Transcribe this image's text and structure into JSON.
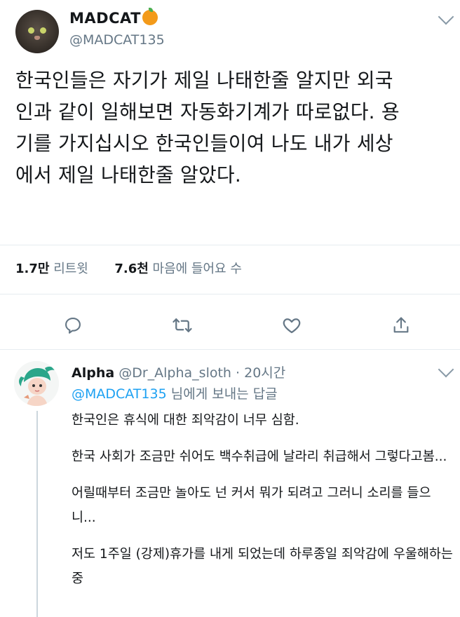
{
  "tweet": {
    "display_name": "MADCAT",
    "handle": "@MADCAT135",
    "text": "한국인들은 자기가 제일 나태한줄 알지만 외국\n인과 같이 일해보면 자동화기계가 따로없다. 용\n기를 가지십시오 한국인들이여 나도 내가 세상\n에서 제일 나태한줄 알았다.",
    "retweet_count": "1.7만",
    "retweet_label": "리트윗",
    "like_count": "7.6천",
    "like_label": "마음에 들어요 수"
  },
  "reply": {
    "display_name": "Alpha",
    "handle": "@Dr_Alpha_sloth",
    "time": "· 20시간",
    "replying_to_handle": "@MADCAT135",
    "replying_to_suffix": "님에게 보내는 답글",
    "paragraphs": [
      "한국인은 휴식에 대한 죄악감이 너무 심함.",
      "한국 사회가 조금만 쉬어도 백수취급에 날라리 취급해서 그렇다고봄...",
      "어릴때부터 조금만 놀아도 넌 커서 뭐가 되려고 그러니 소리를 들으니...",
      "저도 1주일 (강제)휴가를 내게 되었는데 하루종일 죄악감에 우울해하는중"
    ]
  },
  "icons": {
    "verified_emoji": "orange-icon",
    "reply": "reply-icon",
    "retweet": "retweet-icon",
    "like": "heart-icon",
    "share": "share-icon",
    "menu": "chevron-down-icon"
  },
  "colors": {
    "link": "#1da1f2",
    "muted": "#657786",
    "orange": "#f39a1a"
  }
}
